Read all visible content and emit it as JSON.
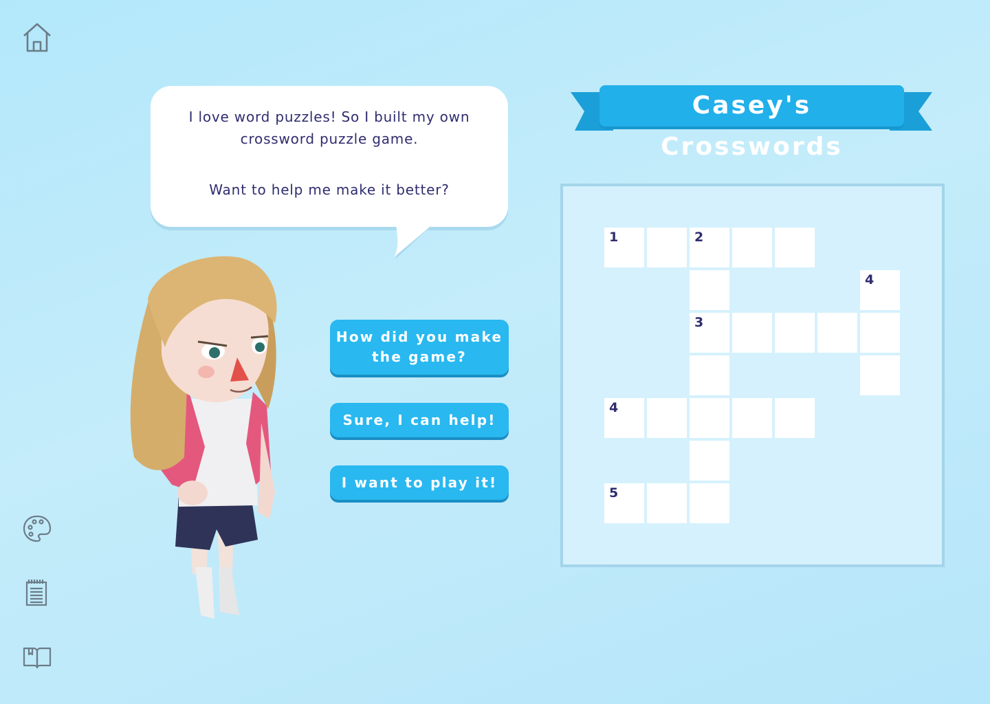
{
  "sidebar": {
    "icons": [
      "home-icon",
      "palette-icon",
      "notepad-icon",
      "book-icon"
    ]
  },
  "speech_bubble": {
    "line1": "I love word puzzles! So I built my own",
    "line2": "crossword puzzle game.",
    "line3": "Want to help me make it better?"
  },
  "choices": {
    "choice1_line1": "How did you make",
    "choice1_line2": "the game?",
    "choice2": "Sure, I can help!",
    "choice3": "I want to play it!"
  },
  "banner": {
    "title": "Casey's Crosswords"
  },
  "crossword": {
    "clue_numbers": [
      "1",
      "2",
      "4",
      "3",
      "4",
      "5"
    ]
  },
  "colors": {
    "accent": "#29b8f0",
    "text_dark": "#2f2d6e",
    "background": "#b3e8fb"
  }
}
